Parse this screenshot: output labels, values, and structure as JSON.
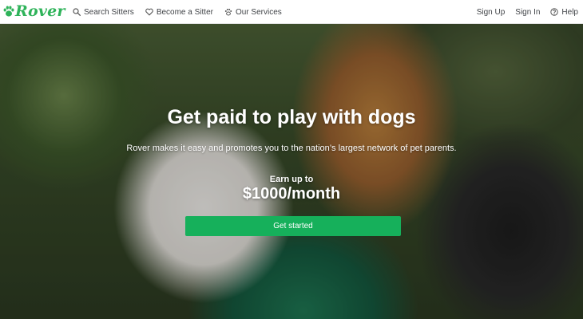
{
  "brand": {
    "name": "Rover",
    "color": "#2fb35a"
  },
  "nav": {
    "left": [
      {
        "label": "Search Sitters",
        "icon": "search-icon"
      },
      {
        "label": "Become a Sitter",
        "icon": "heart-icon"
      },
      {
        "label": "Our Services",
        "icon": "paw-icon"
      }
    ],
    "right": [
      {
        "label": "Sign Up"
      },
      {
        "label": "Sign In"
      },
      {
        "label": "Help",
        "icon": "help-icon"
      }
    ]
  },
  "hero": {
    "title": "Get paid to play with dogs",
    "subtitle": "Rover makes it easy and promotes you to the nation’s largest network of pet parents.",
    "earn_label": "Earn up to",
    "earn_amount": "$1000/month",
    "cta_label": "Get started",
    "cta_color": "#16b05b"
  }
}
